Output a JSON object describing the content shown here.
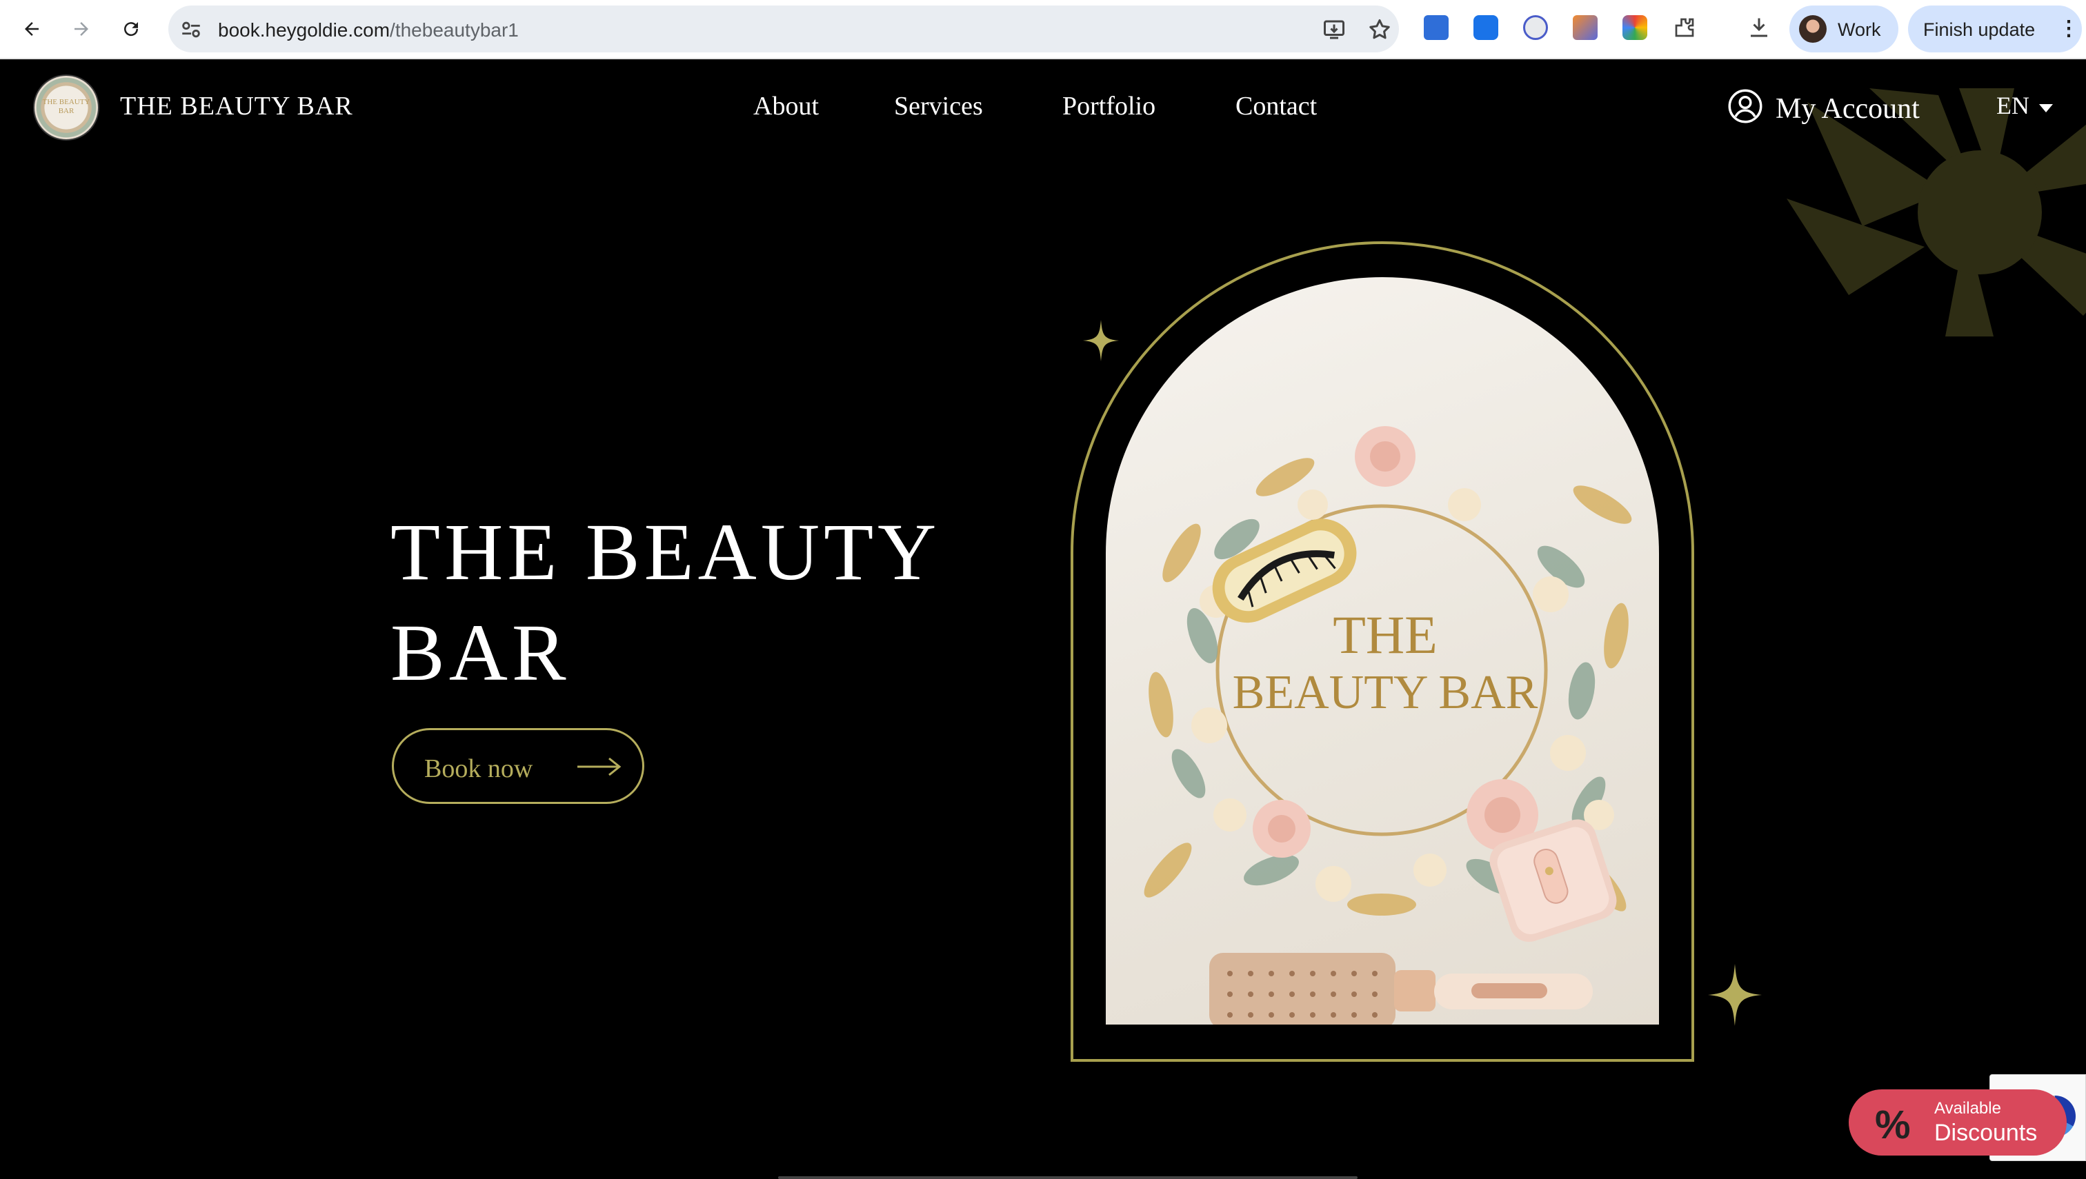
{
  "browser": {
    "url_host": "book.heygoldie.com",
    "url_path": "/thebeautybar1",
    "profile_label": "Work",
    "update_label": "Finish update",
    "icons": [
      "back-icon",
      "forward-icon",
      "reload-icon",
      "site-settings-icon",
      "install-app-icon",
      "bookmark-star-icon",
      "extensions-icon",
      "download-icon",
      "more-menu-icon"
    ]
  },
  "site": {
    "brand_name": "THE BEAUTY BAR",
    "logo_text": "THE BEAUTY BAR",
    "nav": [
      {
        "label": "About"
      },
      {
        "label": "Services"
      },
      {
        "label": "Portfolio"
      },
      {
        "label": "Contact"
      }
    ],
    "account_label": "My Account",
    "language": "EN"
  },
  "hero": {
    "title_line1": "THE BEAUTY",
    "title_line2": "BAR",
    "cta_label": "Book now",
    "image_text_line1": "THE",
    "image_text_line2": "BEAUTY BAR"
  },
  "discounts": {
    "symbol": "%",
    "small_label": "Available",
    "big_label": "Discounts"
  },
  "colors": {
    "background": "#000000",
    "accent_gold": "#b5ad5c",
    "arch_outline": "#a8a04e",
    "deco_olive": "#2e2d14",
    "discount_red": "#d9485b",
    "chrome_chip": "#d3e3fd"
  }
}
